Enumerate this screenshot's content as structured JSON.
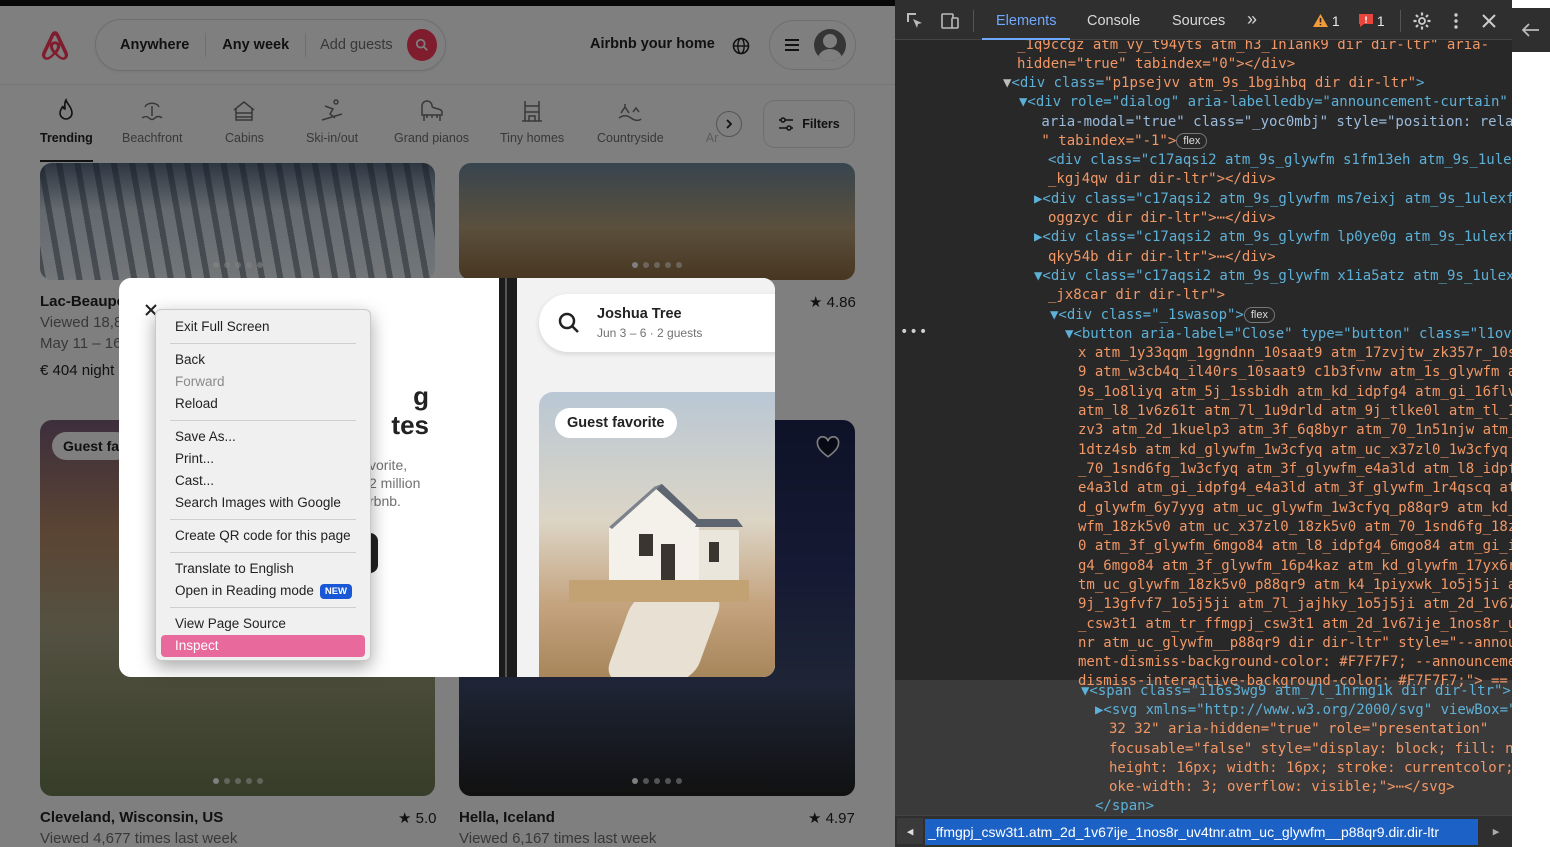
{
  "header": {
    "search": {
      "anywhere": "Anywhere",
      "any_week": "Any week",
      "add_guests": "Add guests"
    },
    "host_link": "Airbnb your home"
  },
  "categories": [
    {
      "label": "Trending",
      "icon": "flame-icon",
      "active": true
    },
    {
      "label": "Beachfront",
      "icon": "beach-icon"
    },
    {
      "label": "Cabins",
      "icon": "cabin-icon"
    },
    {
      "label": "Ski-in/out",
      "icon": "skier-icon"
    },
    {
      "label": "Grand pianos",
      "icon": "piano-icon"
    },
    {
      "label": "Tiny homes",
      "icon": "tiny-home-icon"
    },
    {
      "label": "Countryside",
      "icon": "countryside-icon"
    },
    {
      "label": "Ar",
      "icon": "more-icon"
    }
  ],
  "filters_label": "Filters",
  "listings": [
    {
      "title": "Lac-Beaupo",
      "viewed": "Viewed 18,8",
      "dates": "May 11 – 16",
      "price": "€ 404 night"
    },
    {
      "rating": "★ 4.86"
    },
    {
      "badge": "Guest fa"
    },
    {
      "title": "Cleveland, Wisconsin, US",
      "viewed": "Viewed 4,677 times last week",
      "rating": "★ 5.0"
    },
    {
      "title": "Hella, Iceland",
      "viewed": "Viewed 6,167 times last week",
      "rating": "★ 4.97"
    }
  ],
  "modal": {
    "heading": "g\ntes",
    "body": "vorite,\n2 million\nrbnb.",
    "phone": {
      "search_title": "Joshua Tree",
      "search_sub": "Jun 3 – 6 · 2 guests",
      "badge": "Guest favorite"
    }
  },
  "context_menu": {
    "exit_fullscreen": "Exit Full Screen",
    "back": "Back",
    "forward": "Forward",
    "reload": "Reload",
    "save_as": "Save As...",
    "print": "Print...",
    "cast": "Cast...",
    "search_images": "Search Images with Google",
    "qr": "Create QR code for this page",
    "translate": "Translate to English",
    "reading_mode": "Open in Reading mode",
    "new_badge": "NEW",
    "view_source": "View Page Source",
    "inspect": "Inspect"
  },
  "devtools": {
    "tabs": {
      "elements": "Elements",
      "console": "Console",
      "sources": "Sources",
      "more": "»"
    },
    "warnings": "1",
    "errors": "1",
    "breadcrumb": "_ffmgpj_csw3t1.atm_2d_1v67ije_1nos8r_uv4tnr.atm_uc_glywfm__p88qr9.dir.dir-ltr",
    "pill_flex": "flex",
    "dom": {
      "l0": "_1q9ccgz atm_vy_t94yts atm_h3_1n1ank9 dir dir-ltr\" aria-",
      "l1": "hidden=\"true\" tabindex=\"0\"></div>",
      "l2_tag": "<div class=",
      "l2_val": "\"p1psejvv atm_9s_1bgihbq dir dir-ltr\"",
      "l3": "▼<div role=\"dialog\" aria-labelledby=\"announcement-curtain\"",
      "l4": " aria-modal=\"true\" class=\"_yoc0mbj\" style=\"position: relati",
      "l5": " \" tabindex=\"-1\">",
      "l6": "<div class=\"c17aqsi2 atm_9s_glywfm s1fm13eh atm_9s_1ulex",
      "l7": "_kgj4qw dir dir-ltr\"></div>",
      "l8": "▶<div class=\"c17aqsi2 atm_9s_glywfm ms7eixj atm_9s_1ulexf",
      "l9": "oggzyc dir dir-ltr\">⋯</div>",
      "l10": "▶<div class=\"c17aqsi2 atm_9s_glywfm lp0ye0g atm_9s_1ulexf",
      "l11": "qky54b dir dir-ltr\">⋯</div>",
      "l12": "▼<div class=\"c17aqsi2 atm_9s_glywfm x1ia5atz atm_9s_1ulex",
      "l13": "_jx8car dir dir-ltr\">",
      "l14": "▼<div class=\"_1swasop\">",
      "l15": "▼<button aria-label=\"Close\" type=\"button\" class=\"l1ov",
      "l16": "x atm_1y33qqm_1ggndnn_10saat9 atm_17zvjtw_zk357r_10sa",
      "l17": "9 atm_w3cb4q_il40rs_10saat9 c1b3fvnw atm_1s_glywfm a",
      "l18": "9s_1o8liyq atm_5j_1ssbidh atm_kd_idpfg4 atm_gi_16flv",
      "l19": "atm_l8_1v6z61t atm_7l_1u9drld atm_9j_tlke0l atm_tl_1",
      "l20": "zv3 atm_2d_1kuelp3 atm_3f_6q8byr atm_70_1n51njw atm_",
      "l21": "1dtz4sb atm_kd_glywfm_1w3cfyq atm_uc_x37zl0_1w3cfyq a",
      "l22": "_70_1snd6fg_1w3cfyq atm_3f_glywfm_e4a3ld atm_l8_idpf",
      "l23": "e4a3ld atm_gi_idpfg4_e4a3ld atm_3f_glywfm_1r4qscq at",
      "l24": "d_glywfm_6y7yyg atm_uc_glywfm_1w3cfyq_p88qr9 atm_kd_",
      "l25": "wfm_18zk5v0 atm_uc_x37zl0_18zk5v0 atm_70_1snd6fg_18z",
      "l26": "0 atm_3f_glywfm_6mgo84 atm_l8_idpfg4_6mgo84 atm_gi_i",
      "l27": "g4_6mgo84 atm_3f_glywfm_16p4kaz atm_kd_glywfm_17yx6r",
      "l28": "tm_uc_glywfm_18zk5v0_p88qr9 atm_k4_1piyxwk_1o5j5ji a",
      "l29": "9j_13gfvf7_1o5j5ji atm_7l_jajhky_1o5j5ji atm_2d_1v67",
      "l30": "_csw3t1 atm_tr_ffmgpj_csw3t1 atm_2d_1v67ije_1nos8r_u",
      "l31": "nr atm_uc_glywfm__p88qr9 dir dir-ltr\" style=\"--annou",
      "l32": "ment-dismiss-background-color: #F7F7F7; --announceme",
      "l33": "dismiss-interactive-background-color: #F7F7F7;\"> == $",
      "l34": "▼<span class=\"i16s3wg9 atm_7l_1hrmg1k dir dir-ltr\">",
      "l35": "▶<svg xmlns=\"http://www.w3.org/2000/svg\" viewBox=\"",
      "l36": "32 32\" aria-hidden=\"true\" role=\"presentation\"",
      "l37": "focusable=\"false\" style=\"display: block; fill: no",
      "l38": "height: 16px; width: 16px; stroke: currentcolor;",
      "l39": "oke-width: 3; overflow: visible;\">⋯</svg>",
      "l40": "</span>"
    }
  },
  "colors": {
    "brand": "#ff385c",
    "devtools_accent": "#6fa8ff",
    "inspect_highlight": "#e86a9c"
  }
}
